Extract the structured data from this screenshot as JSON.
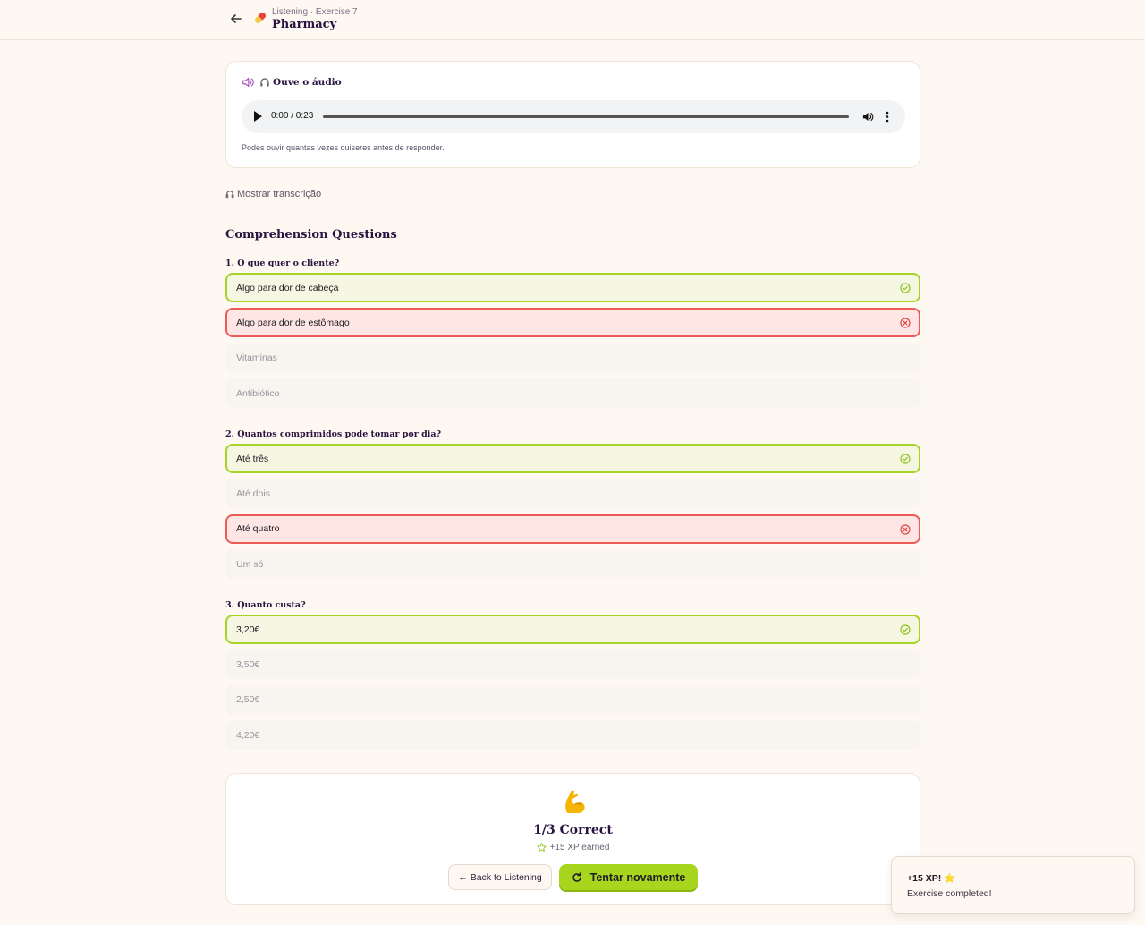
{
  "header": {
    "breadcrumb": "Listening · Exercise 7",
    "title": "Pharmacy",
    "icon": "pill-icon"
  },
  "audio": {
    "heading": "Ouve o áudio",
    "time": "0:00 / 0:23",
    "progress": 0,
    "hint": "Podes ouvir quantas vezes quiseres antes de responder."
  },
  "transcript": {
    "toggle_label": "Mostrar transcrição"
  },
  "section_title": "Comprehension Questions",
  "questions": [
    {
      "title": "1. O que quer o cliente?",
      "options": [
        {
          "label": "Algo para dor de cabeça",
          "state": "correct"
        },
        {
          "label": "Algo para dor de estômago",
          "state": "wrong"
        },
        {
          "label": "Vitaminas",
          "state": "neutral"
        },
        {
          "label": "Antibiótico",
          "state": "neutral"
        }
      ]
    },
    {
      "title": "2. Quantos comprimidos pode tomar por dia?",
      "options": [
        {
          "label": "Até três",
          "state": "correct"
        },
        {
          "label": "Até dois",
          "state": "neutral"
        },
        {
          "label": "Até quatro",
          "state": "wrong"
        },
        {
          "label": "Um só",
          "state": "neutral"
        }
      ]
    },
    {
      "title": "3. Quanto custa?",
      "options": [
        {
          "label": "3,20€",
          "state": "correct"
        },
        {
          "label": "3,50€",
          "state": "neutral"
        },
        {
          "label": "2,50€",
          "state": "neutral"
        },
        {
          "label": "4,20€",
          "state": "neutral"
        }
      ]
    }
  ],
  "result": {
    "emoji": "flexed-biceps-icon",
    "score": "1/3 Correct",
    "xp": "+15 XP earned",
    "back_label": "← Back to Listening",
    "retry_label": "Tentar novamente"
  },
  "toast": {
    "title": "+15 XP! ⭐",
    "message": "Exercise completed!"
  },
  "colors": {
    "correct_border": "#a5d425",
    "wrong_border": "#ec5b57",
    "accent": "#a8d61e",
    "heading": "#2a1340",
    "speaker_purple": "#a64fc2"
  }
}
